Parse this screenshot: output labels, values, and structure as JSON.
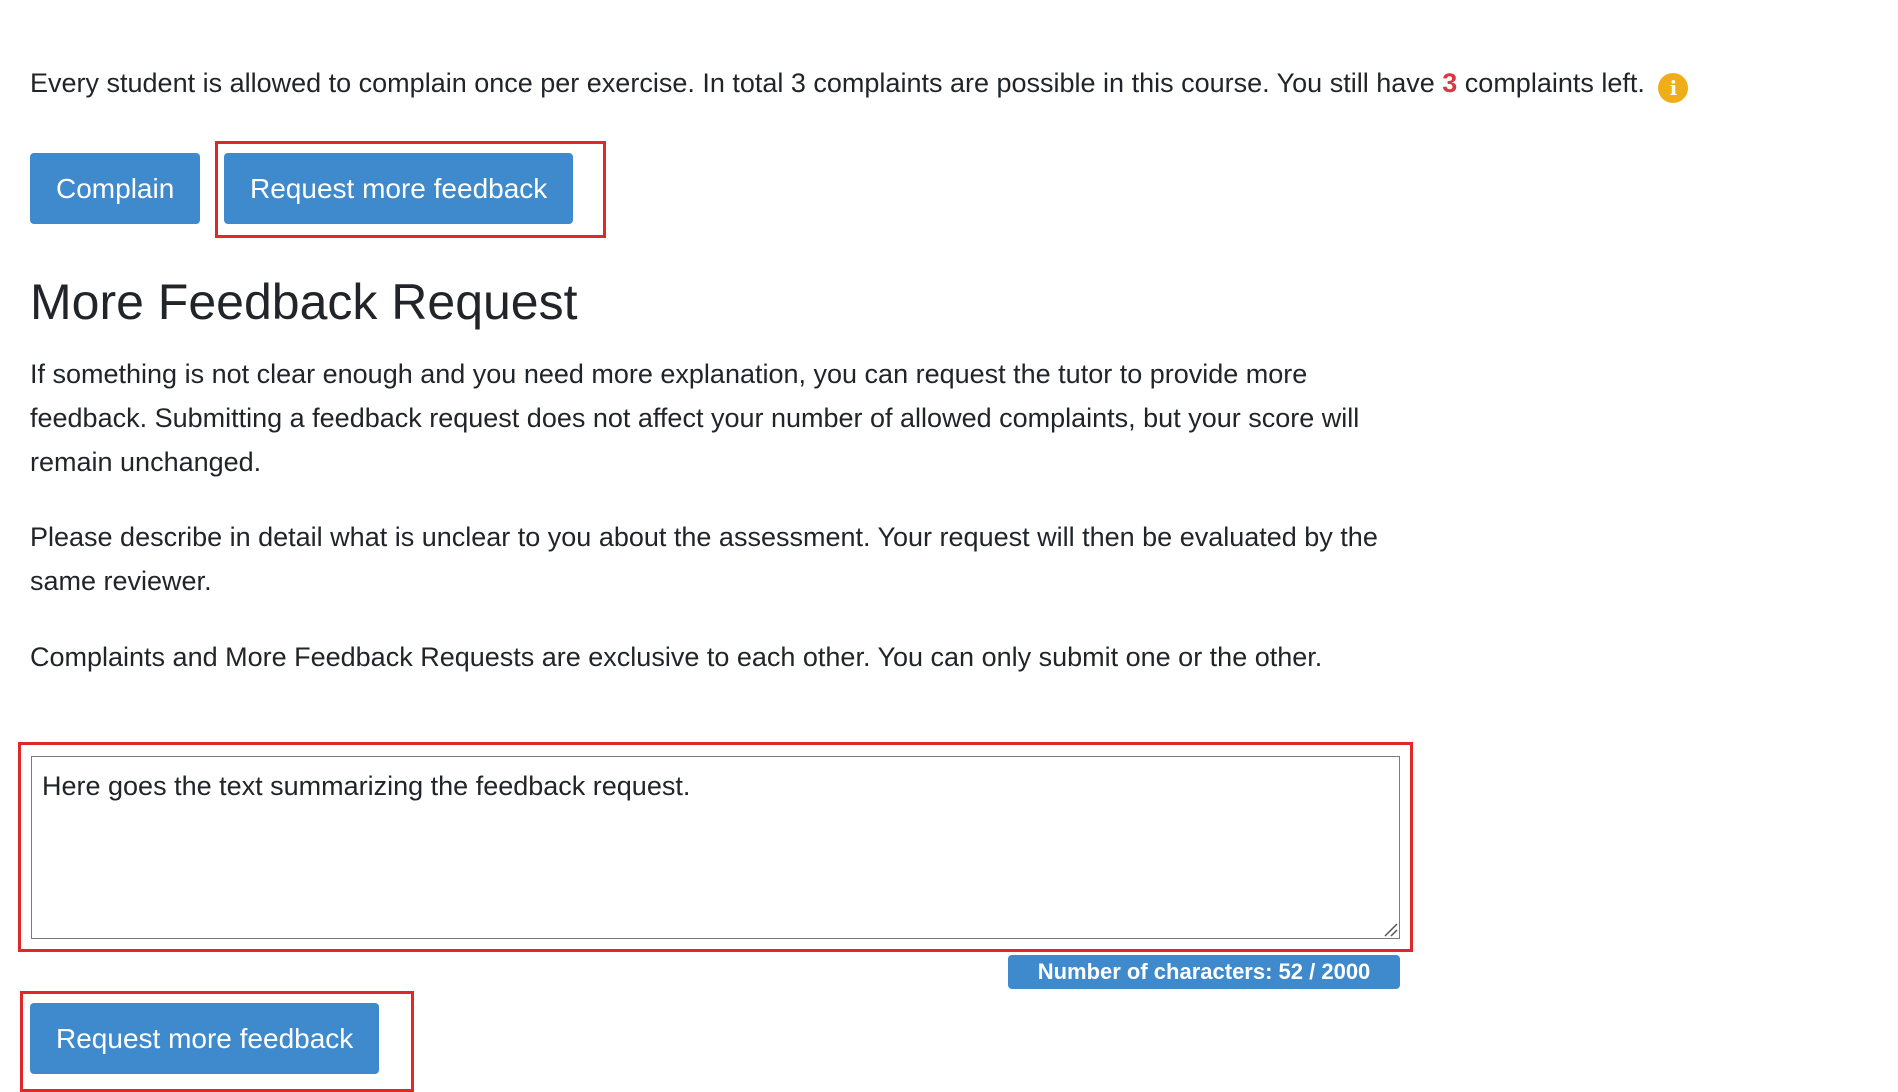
{
  "complaint_info": {
    "text_before": "Every student is allowed to complain once per exercise. In total 3 complaints are possible in this course. You still have ",
    "remaining_count": "3",
    "text_after": " complaints left.",
    "info_icon": "info-circle-icon",
    "info_icon_glyph": "i"
  },
  "actions": {
    "complain_label": "Complain",
    "request_feedback_label": "Request more feedback"
  },
  "feedback_section": {
    "title": "More Feedback Request",
    "paragraphs": [
      "If something is not clear enough and you need more explanation, you can request the tutor to provide more feedback. Submitting a feedback request does not affect your number of allowed complaints, but your score will remain unchanged.",
      "Please describe in detail what is unclear to you about the assessment. Your request will then be evaluated by the same reviewer.",
      "Complaints and More Feedback Requests are exclusive to each other. You can only submit one or the other."
    ],
    "textarea_value": "Here goes the text summarizing the feedback request.",
    "char_count_label": "Number of characters: 52 / 2000",
    "submit_label": "Request more feedback"
  },
  "colors": {
    "primary_button": "#3e8acc",
    "highlight_border": "#e0282a",
    "count_red": "#dc3545",
    "info_icon": "#f0ad1a"
  }
}
